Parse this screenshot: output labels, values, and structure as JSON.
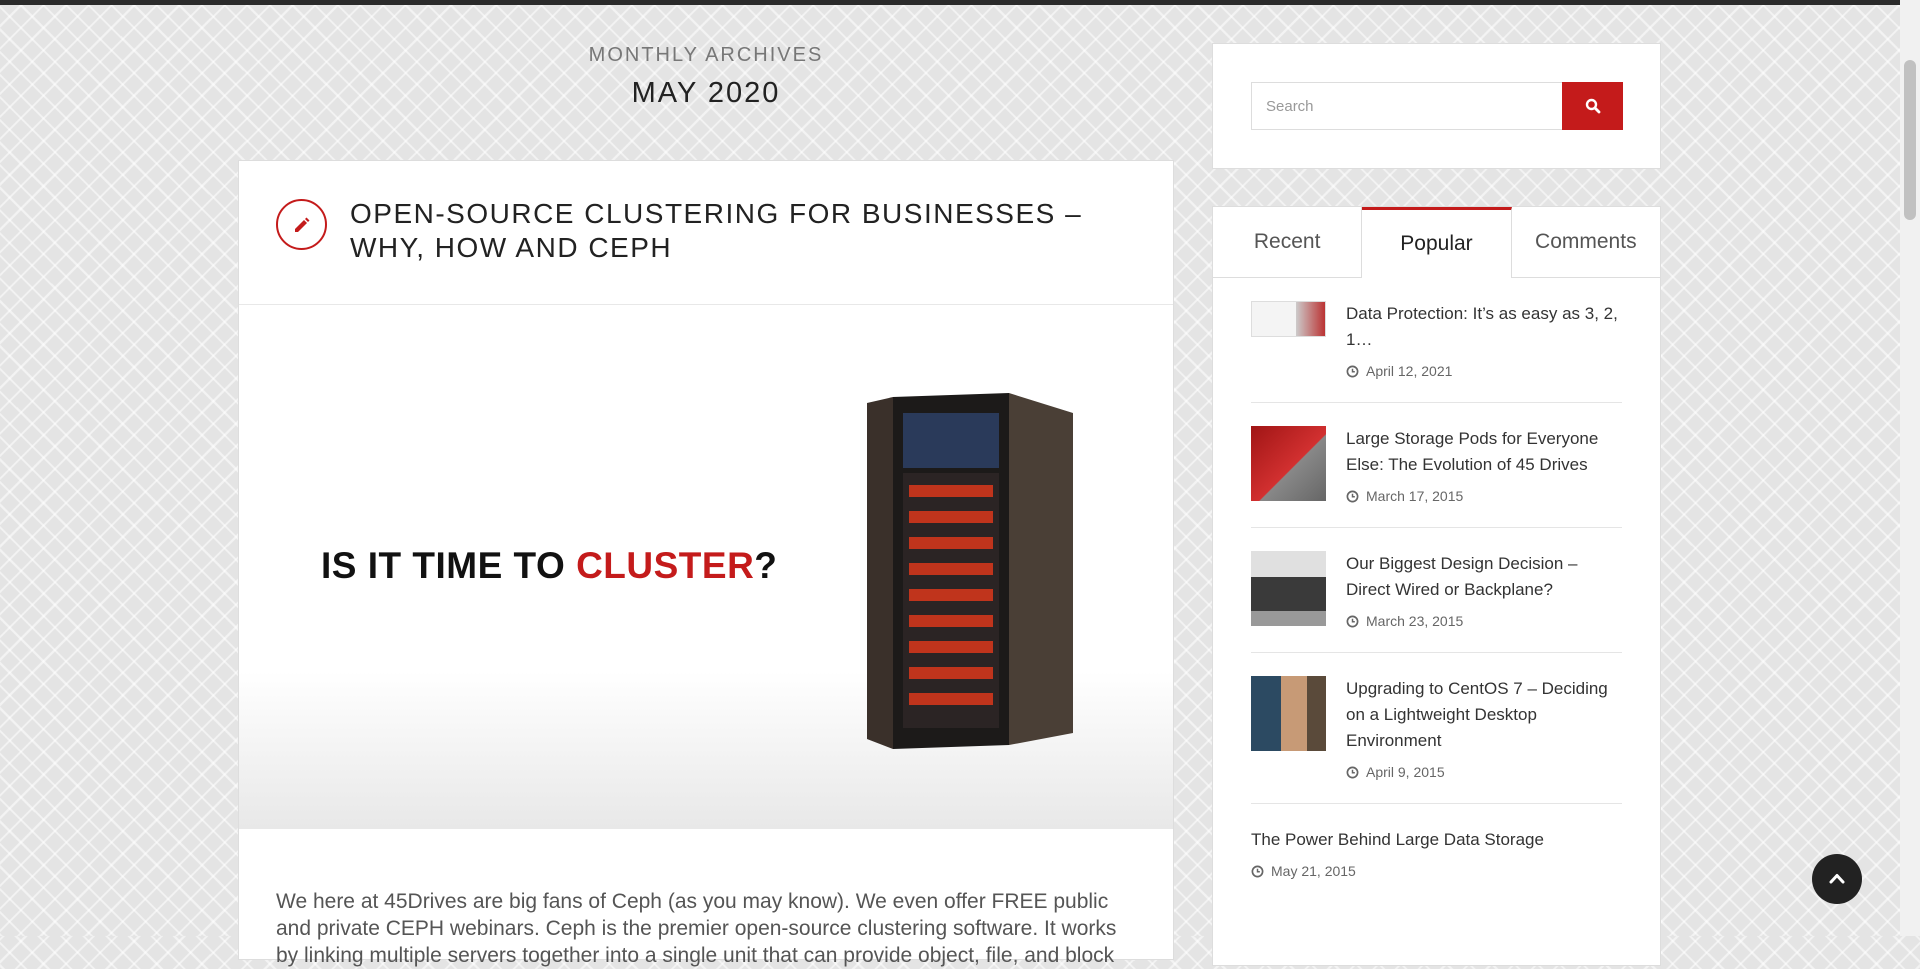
{
  "archive": {
    "label": "MONTHLY ARCHIVES",
    "title": "MAY 2020"
  },
  "post": {
    "title": "OPEN-SOURCE CLUSTERING FOR BUSINESSES – WHY, HOW AND CEPH",
    "image_text_prefix": "IS IT TIME TO ",
    "image_text_highlight": "CLUSTER",
    "image_text_suffix": "?",
    "excerpt": "We here at 45Drives are big fans of Ceph (as you may know). We even offer FREE public and private CEPH webinars. Ceph is the premier open-source clustering software. It works by linking multiple servers together into a single unit that can provide object, file, and block"
  },
  "search": {
    "placeholder": "Search"
  },
  "tabs": {
    "recent": "Recent",
    "popular": "Popular",
    "comments": "Comments"
  },
  "popular_posts": [
    {
      "title": "Data Protection: It’s as easy as 3, 2, 1…",
      "date": "April 12, 2021"
    },
    {
      "title": "Large Storage Pods for Everyone Else: The Evolution of 45 Drives",
      "date": "March 17, 2015"
    },
    {
      "title": "Our Biggest Design Decision – Direct Wired or Backplane?",
      "date": "March 23, 2015"
    },
    {
      "title": "Upgrading to CentOS 7 – Deciding on a Lightweight Desktop Environment",
      "date": "April 9, 2015"
    },
    {
      "title": "The Power Behind Large Data Storage",
      "date": "May 21, 2015"
    }
  ],
  "colors": {
    "accent": "#c41b1b",
    "text": "#222222",
    "muted": "#777777"
  },
  "icons": {
    "post_icon": "pencil-icon",
    "search_button": "search-icon",
    "date": "clock-icon",
    "back_to_top": "chevron-up-icon"
  }
}
